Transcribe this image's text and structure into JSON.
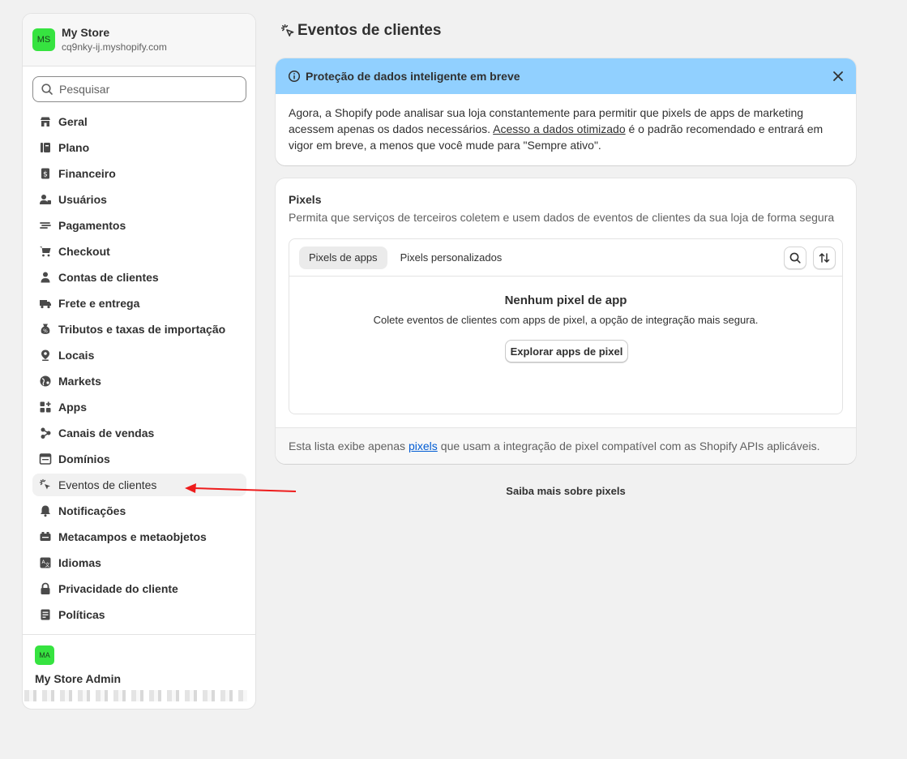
{
  "sidebar": {
    "store": {
      "avatar": "MS",
      "name": "My Store",
      "domain": "cq9nky-ij.myshopify.com"
    },
    "search": {
      "placeholder": "Pesquisar"
    },
    "items": [
      {
        "label": "Geral",
        "icon": "store-icon"
      },
      {
        "label": "Plano",
        "icon": "plan-icon"
      },
      {
        "label": "Financeiro",
        "icon": "finance-icon"
      },
      {
        "label": "Usuários",
        "icon": "users-icon"
      },
      {
        "label": "Pagamentos",
        "icon": "payments-icon"
      },
      {
        "label": "Checkout",
        "icon": "cart-icon"
      },
      {
        "label": "Contas de clientes",
        "icon": "person-icon"
      },
      {
        "label": "Frete e entrega",
        "icon": "truck-icon"
      },
      {
        "label": "Tributos e taxas de importação",
        "icon": "tax-icon"
      },
      {
        "label": "Locais",
        "icon": "location-icon"
      },
      {
        "label": "Markets",
        "icon": "globe-icon"
      },
      {
        "label": "Apps",
        "icon": "apps-icon"
      },
      {
        "label": "Canais de vendas",
        "icon": "channels-icon"
      },
      {
        "label": "Domínios",
        "icon": "domain-icon"
      },
      {
        "label": "Eventos de clientes",
        "icon": "cursor-click-icon",
        "active": true
      },
      {
        "label": "Notificações",
        "icon": "bell-icon"
      },
      {
        "label": "Metacampos e metaobjetos",
        "icon": "metafields-icon"
      },
      {
        "label": "Idiomas",
        "icon": "language-icon"
      },
      {
        "label": "Privacidade do cliente",
        "icon": "lock-icon"
      },
      {
        "label": "Políticas",
        "icon": "policy-icon"
      }
    ],
    "footer": {
      "avatar": "MA",
      "name": "My Store Admin"
    }
  },
  "page": {
    "title": "Eventos de clientes"
  },
  "banner": {
    "title": "Proteção de dados inteligente em breve",
    "body_1": "Agora, a Shopify pode analisar sua loja constantemente para permitir que pixels de apps de marketing acessem apenas os dados necessários.",
    "link": "Acesso a dados otimizado",
    "body_2": "é o padrão recomendado e entrará em vigor em breve, a menos que você mude para \"Sempre ativo\"."
  },
  "pixels": {
    "title": "Pixels",
    "subtitle": "Permita que serviços de terceiros coletem e usem dados de eventos de clientes da sua loja de forma segura",
    "tabs": [
      "Pixels de apps",
      "Pixels personalizados"
    ],
    "empty_title": "Nenhum pixel de app",
    "empty_desc": "Colete eventos de clientes com apps de pixel, a opção de integração mais segura.",
    "explore_button": "Explorar apps de pixel",
    "footer_pre": "Esta lista exibe apenas",
    "footer_link": "pixels",
    "footer_post": "que usam a integração de pixel compatível com as Shopify APIs aplicáveis."
  },
  "learn_more": "Saiba mais sobre pixels",
  "colors": {
    "accent_green": "#36e340",
    "banner_blue": "#91d0ff",
    "link_blue": "#005bd3",
    "arrow_red": "#ee1c1c"
  }
}
